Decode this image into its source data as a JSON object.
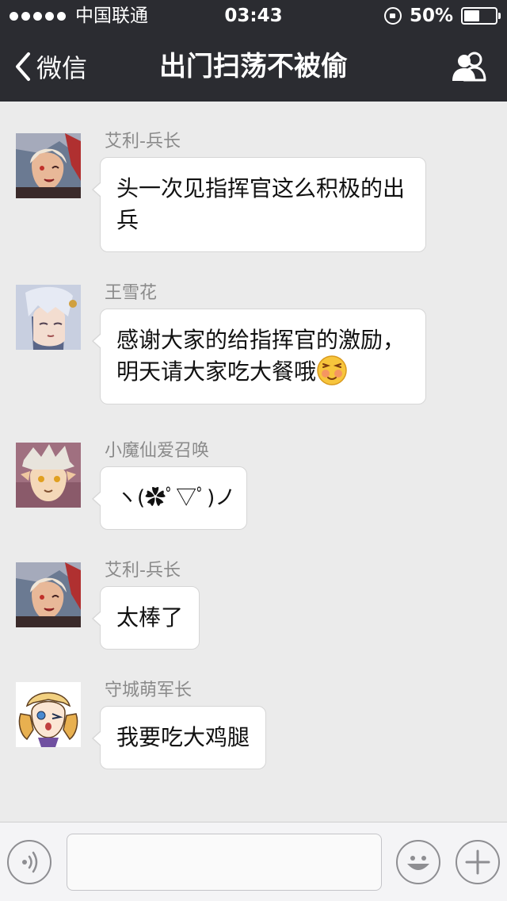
{
  "status_bar": {
    "carrier": "中国联通",
    "time": "03:43",
    "battery": "50%"
  },
  "nav": {
    "back_label": "微信",
    "title": "出门扫荡不被偷"
  },
  "messages": [
    {
      "sender": "艾利-兵长",
      "lines": [
        "头一次见指挥官这么积极的出",
        "兵"
      ]
    },
    {
      "sender": "王雪花",
      "lines": [
        "感谢大家的给指挥官的激励，",
        "明天请大家吃大餐哦"
      ],
      "trailing_emoji": "blushing-face-emoji"
    },
    {
      "sender": "小魔仙爱召唤",
      "lines": [
        "ヽ(✿ﾟ▽ﾟ)ノ"
      ]
    },
    {
      "sender": "艾利-兵长",
      "lines": [
        "太棒了"
      ]
    },
    {
      "sender": "守城萌军长",
      "lines": [
        "我要吃大鸡腿"
      ]
    }
  ],
  "input": {
    "placeholder": ""
  },
  "colors": {
    "header_bg": "#2b2c31",
    "chat_bg": "#ebebeb",
    "bubble_bg": "#ffffff"
  }
}
